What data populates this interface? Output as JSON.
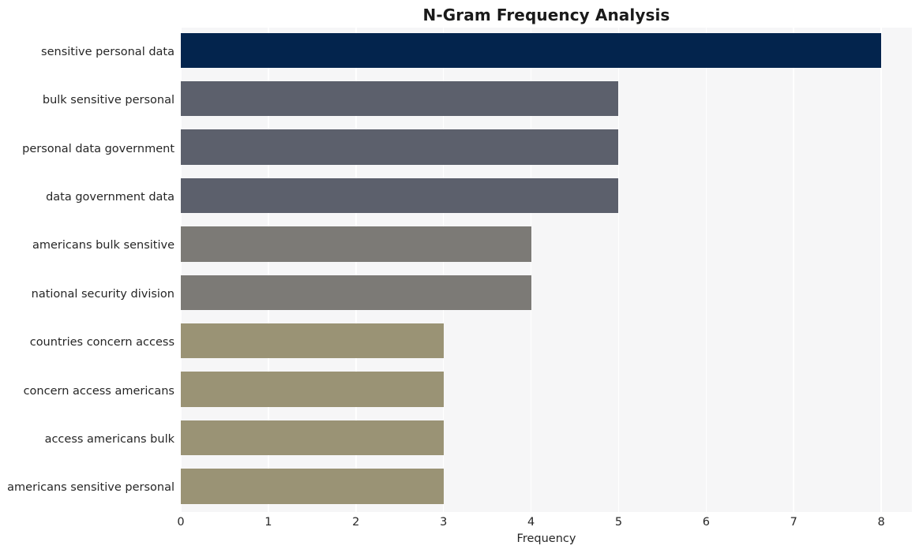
{
  "chart_data": {
    "type": "bar",
    "orientation": "horizontal",
    "title": "N-Gram Frequency Analysis",
    "xlabel": "Frequency",
    "ylabel": "",
    "xlim": [
      0,
      8.35
    ],
    "ylim": [
      0,
      10
    ],
    "grid": "vertical-only",
    "legend": "none",
    "xticks": [
      "0",
      "1",
      "2",
      "3",
      "4",
      "5",
      "6",
      "7",
      "8"
    ],
    "xtick_values": [
      0,
      1,
      2,
      3,
      4,
      5,
      6,
      7,
      8
    ],
    "categories": [
      "sensitive personal data",
      "bulk sensitive personal",
      "personal data government",
      "data government data",
      "americans bulk sensitive",
      "national security division",
      "countries concern access",
      "concern access americans",
      "access americans bulk",
      "americans sensitive personal"
    ],
    "values": [
      8,
      5,
      5,
      5,
      4,
      4,
      3,
      3,
      3,
      3
    ],
    "bar_colors": [
      "#03244d",
      "#5c606c",
      "#5c606c",
      "#5c606c",
      "#7c7a76",
      "#7c7a76",
      "#9a9375",
      "#9a9375",
      "#9a9375",
      "#9a9375"
    ],
    "plot_background": "#f6f6f7",
    "gridline_color": "#ffffff",
    "figure_background": "#ffffff",
    "text_color": "#262626"
  }
}
